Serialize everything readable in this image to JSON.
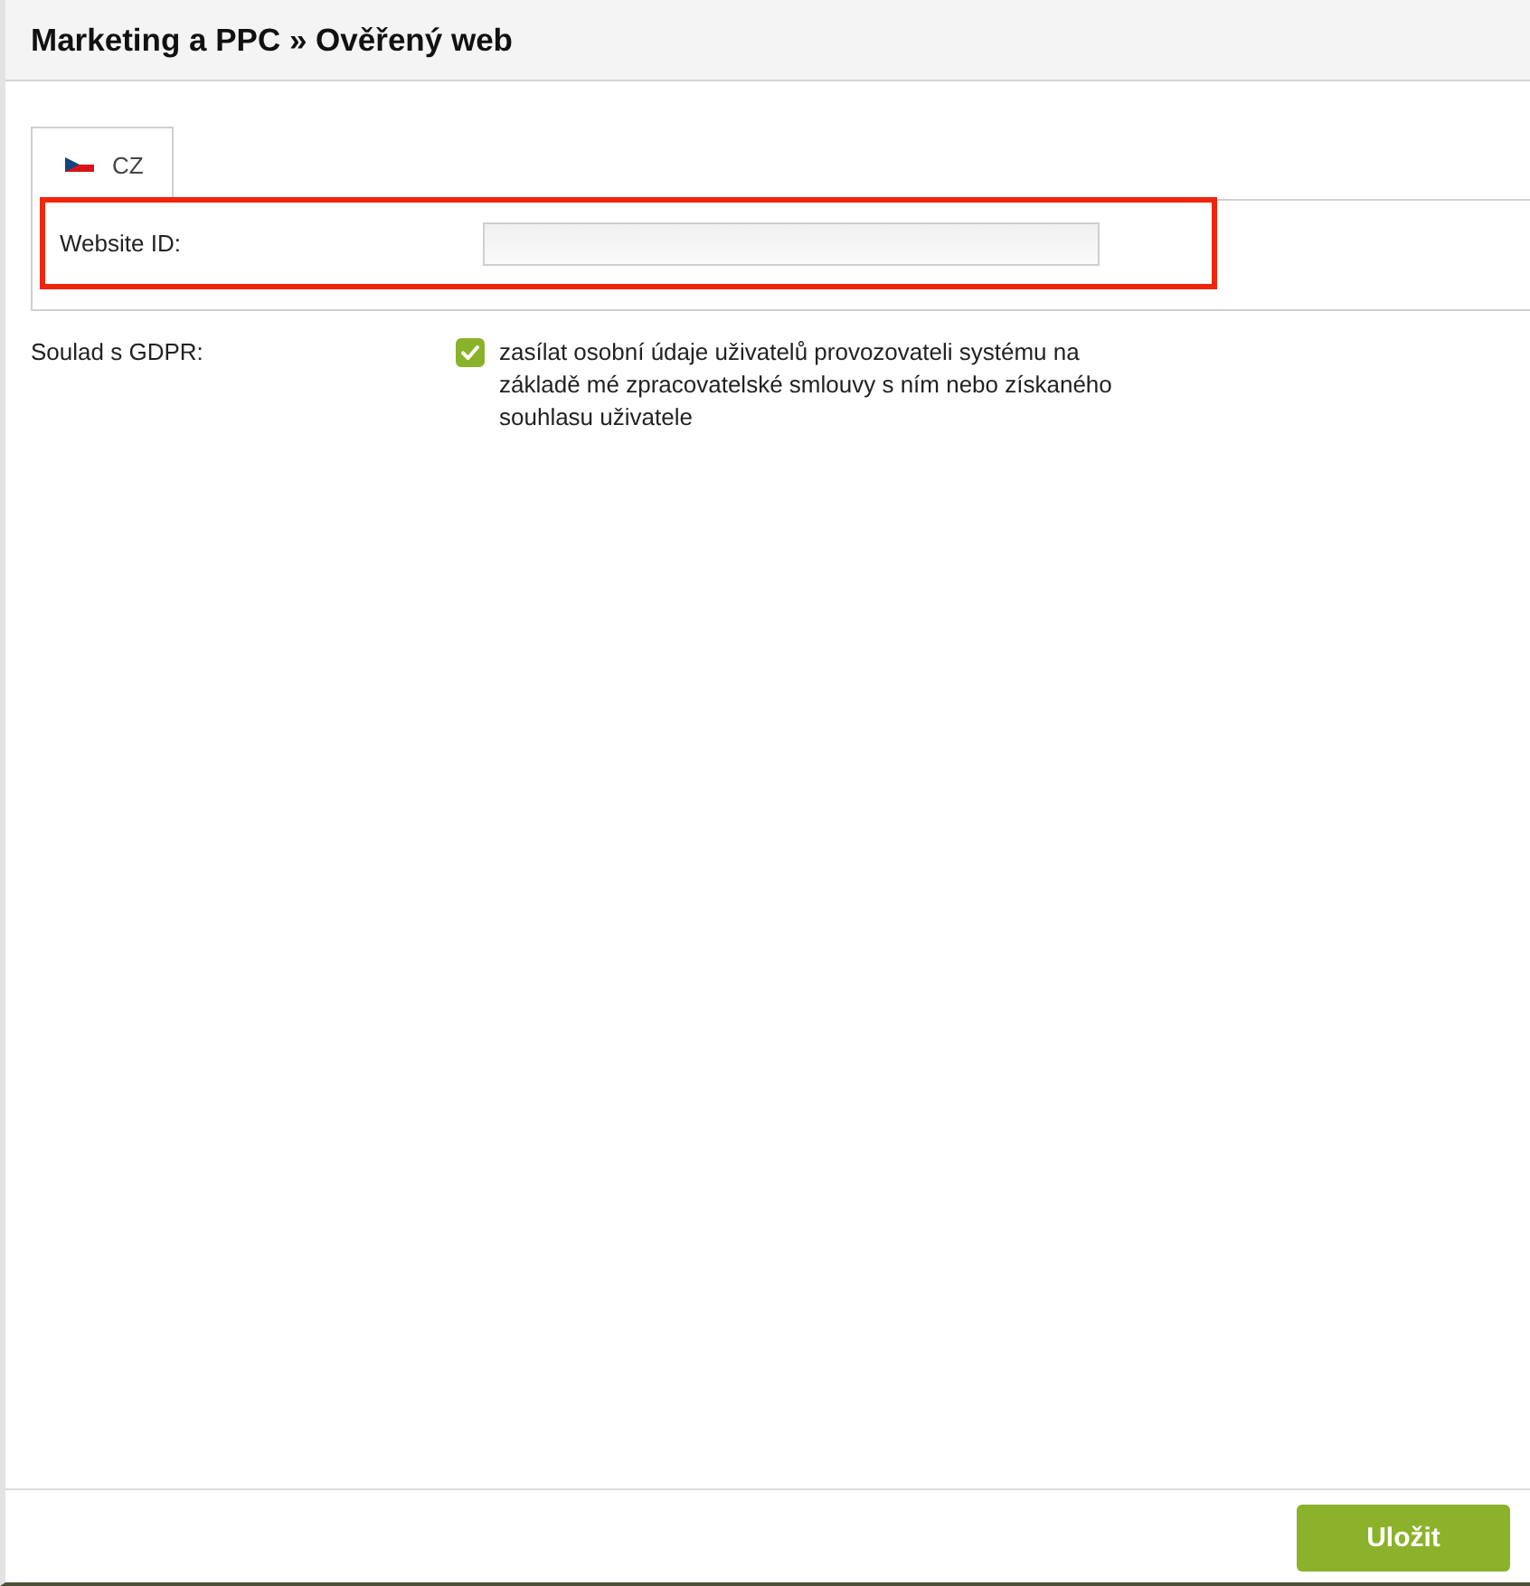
{
  "header": {
    "title": "Marketing a PPC » Ověřený web"
  },
  "tabs": [
    {
      "label": "CZ",
      "selected": true
    }
  ],
  "fields": [
    {
      "label": "Website ID:",
      "highlighted": true
    }
  ],
  "gdpr": {
    "label": "Soulad s GDPR:",
    "checked": true,
    "text": "zasílat osobní údaje uživatelů provozovateli systému na základě mé zpracovatelské smlouvy s ním nebo získaného souhlasu uživatele"
  },
  "footer": {
    "button": "Uložit"
  }
}
